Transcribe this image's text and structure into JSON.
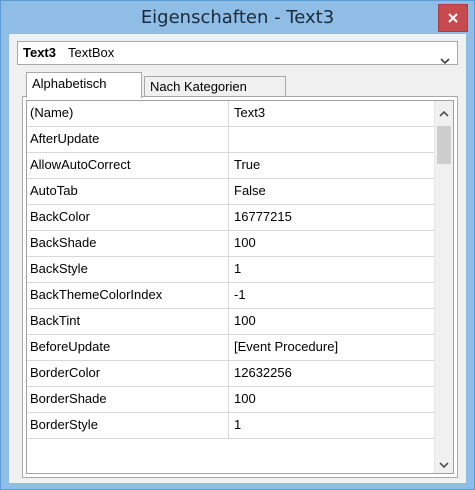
{
  "window": {
    "title": "Eigenschaften - Text3"
  },
  "object_selector": {
    "name": "Text3",
    "type": "TextBox"
  },
  "tabs": [
    {
      "label": "Alphabetisch",
      "active": true
    },
    {
      "label": "Nach Kategorien",
      "active": false
    }
  ],
  "properties": [
    {
      "name": "(Name)",
      "value": "Text3"
    },
    {
      "name": "AfterUpdate",
      "value": ""
    },
    {
      "name": "AllowAutoCorrect",
      "value": "True"
    },
    {
      "name": "AutoTab",
      "value": "False"
    },
    {
      "name": "BackColor",
      "value": "16777215"
    },
    {
      "name": "BackShade",
      "value": "100"
    },
    {
      "name": "BackStyle",
      "value": "1"
    },
    {
      "name": "BackThemeColorIndex",
      "value": "-1"
    },
    {
      "name": "BackTint",
      "value": "100"
    },
    {
      "name": "BeforeUpdate",
      "value": "[Event Procedure]"
    },
    {
      "name": "BorderColor",
      "value": "12632256"
    },
    {
      "name": "BorderShade",
      "value": "100"
    },
    {
      "name": "BorderStyle",
      "value": "1"
    }
  ],
  "colors": {
    "window_frame": "#8fbde6",
    "close_button": "#c74a4f",
    "client_bg": "#f0f0f0",
    "grid_line": "#d8d8d8"
  },
  "icons": {
    "close": "close-icon",
    "dropdown": "chevron-down-icon",
    "scroll_up": "chevron-up-icon",
    "scroll_down": "chevron-down-icon"
  }
}
